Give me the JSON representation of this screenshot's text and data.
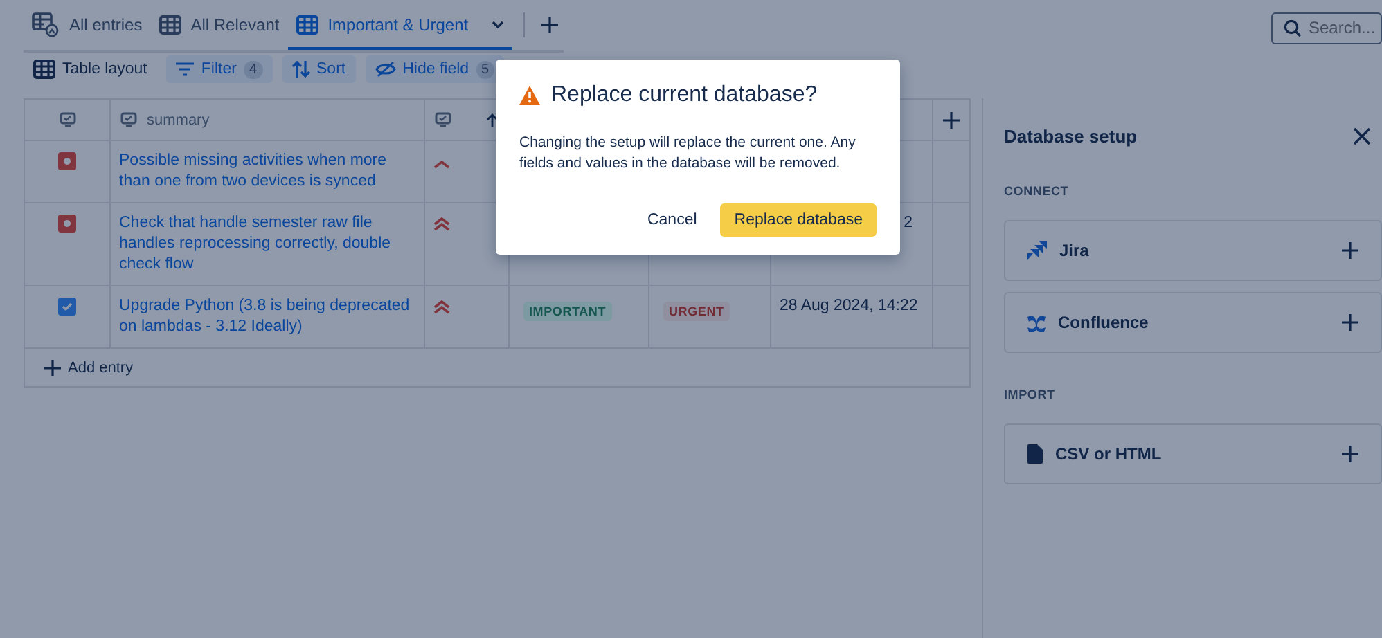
{
  "tabs": [
    {
      "label": "All entries",
      "selected": false
    },
    {
      "label": "All Relevant",
      "selected": false
    },
    {
      "label": "Important & Urgent",
      "selected": true
    }
  ],
  "search": {
    "placeholder": "Search..."
  },
  "toolbar": [
    {
      "label": "Table layout",
      "kind": "plain"
    },
    {
      "label": "Filter",
      "kind": "filter",
      "count": "4"
    },
    {
      "label": "Sort",
      "kind": "sort"
    },
    {
      "label": "Hide field",
      "kind": "hide",
      "count": "5"
    }
  ],
  "table": {
    "columns": [
      {},
      {
        "label": "summary"
      },
      {
        "sorted": true
      }
    ],
    "rows": [
      {
        "checked": false,
        "summary": "Possible missing activities when more than one from two devices is synced",
        "priority": {
          "kind": "high"
        }
      },
      {
        "checked": false,
        "summary": "Check that handle semester raw file handles reprocessing correctly, double check flow",
        "priority": {
          "kind": "highest"
        },
        "date": "2"
      },
      {
        "checked": true,
        "summary": "Upgrade Python (3.8 is being deprecated on lambdas - 3.12 Ideally)",
        "priority": {
          "kind": "highest"
        },
        "tags": [
          "IMPORTANT",
          "URGENT"
        ],
        "date": "28 Aug 2024, 14:22"
      }
    ],
    "add_entry": "Add entry"
  },
  "panel": {
    "title": "Database setup",
    "sections": [
      {
        "heading": "CONNECT",
        "items": [
          {
            "label": "Jira"
          },
          {
            "label": "Confluence"
          }
        ]
      },
      {
        "heading": "IMPORT",
        "items": [
          {
            "label": "CSV or HTML"
          }
        ]
      }
    ]
  },
  "dialog": {
    "title": "Replace current database?",
    "body": "Changing the setup will replace the current one. Any fields and values in the database will be removed.",
    "cancel": "Cancel",
    "confirm": "Replace database"
  }
}
